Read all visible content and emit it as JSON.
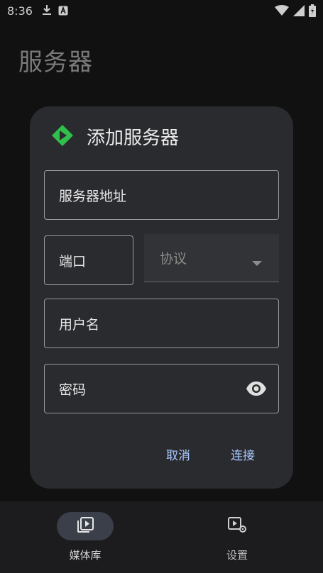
{
  "status_bar": {
    "time": "8:36",
    "left_icons": [
      "download-icon",
      "app-notification-icon"
    ],
    "right_icons": [
      "wifi-icon",
      "signal-icon",
      "battery-charging-icon"
    ]
  },
  "page": {
    "title": "服务器"
  },
  "dialog": {
    "icon": "app-logo-icon",
    "title": "添加服务器",
    "server_address_placeholder": "服务器地址",
    "port_placeholder": "端口",
    "protocol_placeholder": "协议",
    "username_placeholder": "用户名",
    "password_placeholder": "密码",
    "cancel_label": "取消",
    "connect_label": "连接"
  },
  "bottom_nav": {
    "items": [
      {
        "label": "媒体库",
        "icon": "media-library-icon",
        "active": true
      },
      {
        "label": "设置",
        "icon": "settings-play-icon",
        "active": false
      }
    ]
  },
  "colors": {
    "accent": "#a9c7ff",
    "logo": "#2fbf4a",
    "dialog_bg": "#2a2b2e",
    "background": "#141414"
  }
}
